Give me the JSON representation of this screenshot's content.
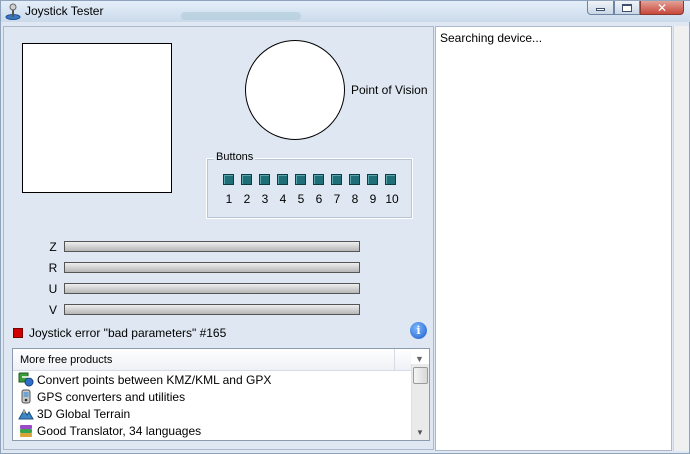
{
  "window": {
    "title": "Joystick Tester",
    "icon": "joystick-icon"
  },
  "pov": {
    "label": "Point of Vision"
  },
  "buttons_group": {
    "legend": "Buttons",
    "buttons": [
      "1",
      "2",
      "3",
      "4",
      "5",
      "6",
      "7",
      "8",
      "9",
      "10"
    ],
    "indicator_color": "#1f6e78"
  },
  "axes": [
    {
      "label": "Z"
    },
    {
      "label": "R"
    },
    {
      "label": "U"
    },
    {
      "label": "V"
    }
  ],
  "status": {
    "error_text": "Joystick error \"bad parameters\" #165",
    "error_color": "#d00000",
    "info_icon": "info-icon"
  },
  "products": {
    "header": "More free products",
    "items": [
      {
        "label": "Convert points between KMZ/KML and GPX",
        "icon": "kmz-gpx-icon"
      },
      {
        "label": "GPS converters and utilities",
        "icon": "gps-icon"
      },
      {
        "label": "3D Global Terrain",
        "icon": "terrain-icon"
      },
      {
        "label": "Good Translator, 34 languages",
        "icon": "translator-icon"
      }
    ]
  },
  "log": {
    "text": "Searching device..."
  }
}
